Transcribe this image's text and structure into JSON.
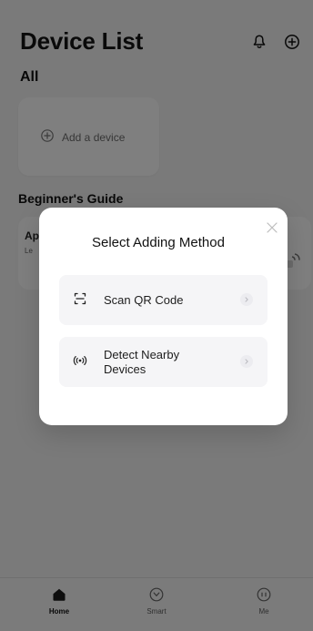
{
  "header": {
    "title": "Device List",
    "subtitle": "All",
    "icons": {
      "notifications": "bell-icon",
      "add": "plus-circle-icon"
    }
  },
  "device_section": {
    "add_label": "Add a device"
  },
  "guide": {
    "title": "Beginner's Guide",
    "card_title": "Ap",
    "card_sub": "Le"
  },
  "modal": {
    "title": "Select Adding Method",
    "close_icon": "close-icon",
    "options": [
      {
        "label": "Scan QR Code",
        "icon": "scan-icon"
      },
      {
        "label": "Detect Nearby Devices",
        "icon": "nearby-signal-icon"
      }
    ]
  },
  "bottom_nav": {
    "items": [
      {
        "label": "Home",
        "icon": "home-icon",
        "active": true
      },
      {
        "label": "Smart",
        "icon": "smart-icon",
        "active": false
      },
      {
        "label": "Me",
        "icon": "me-icon",
        "active": false
      }
    ]
  },
  "colors": {
    "overlay": "#000000",
    "modal_bg": "#FFFFFF",
    "option_bg": "#F5F5F7",
    "text_dark": "#111111",
    "text_muted": "#666666"
  }
}
